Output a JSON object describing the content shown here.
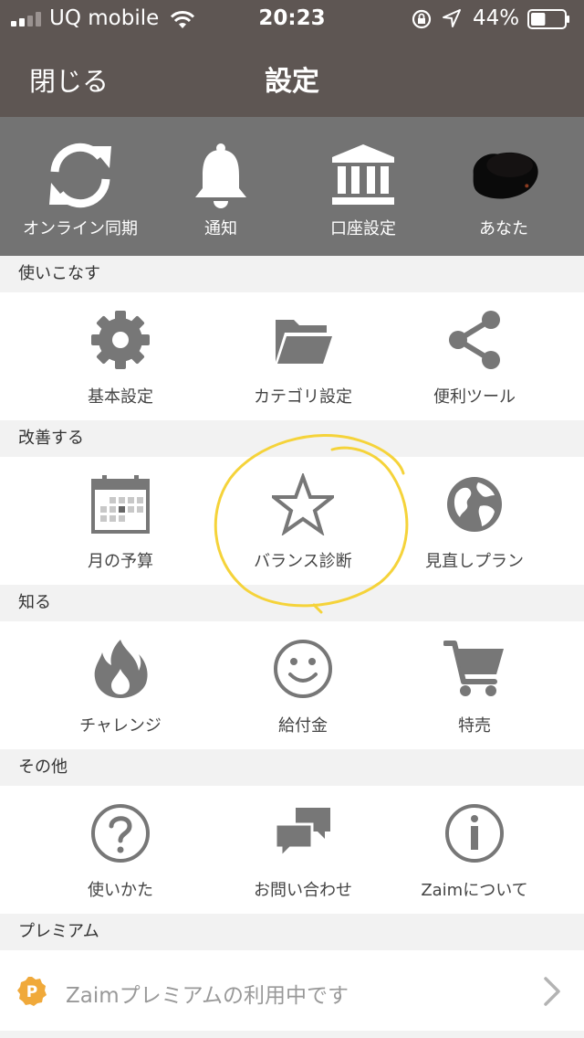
{
  "status_bar": {
    "carrier": "UQ mobile",
    "time": "20:23",
    "battery_percent": "44%",
    "battery_level": 0.44,
    "signal_bars_filled": 2,
    "signal_bars_total": 4
  },
  "nav": {
    "close_label": "閉じる",
    "title": "設定"
  },
  "top_menu": {
    "items": [
      {
        "label": "オンライン同期",
        "icon": "sync-icon"
      },
      {
        "label": "通知",
        "icon": "bell-icon"
      },
      {
        "label": "口座設定",
        "icon": "bank-icon"
      },
      {
        "label": "あなた",
        "icon": "avatar"
      }
    ]
  },
  "sections": [
    {
      "title": "使いこなす",
      "items": [
        {
          "label": "基本設定",
          "icon": "gear-icon"
        },
        {
          "label": "カテゴリ設定",
          "icon": "folder-icon"
        },
        {
          "label": "便利ツール",
          "icon": "share-icon"
        }
      ]
    },
    {
      "title": "改善する",
      "items": [
        {
          "label": "月の予算",
          "icon": "calendar-icon"
        },
        {
          "label": "バランス診断",
          "icon": "star-icon"
        },
        {
          "label": "見直しプラン",
          "icon": "globe-icon"
        }
      ]
    },
    {
      "title": "知る",
      "items": [
        {
          "label": "チャレンジ",
          "icon": "fire-icon"
        },
        {
          "label": "給付金",
          "icon": "smile-icon"
        },
        {
          "label": "特売",
          "icon": "cart-icon"
        }
      ]
    },
    {
      "title": "その他",
      "items": [
        {
          "label": "使いかた",
          "icon": "help-icon"
        },
        {
          "label": "お問い合わせ",
          "icon": "chat-icon"
        },
        {
          "label": "Zaimについて",
          "icon": "info-icon"
        }
      ]
    }
  ],
  "premium": {
    "section_title": "プレミアム",
    "badge": "P",
    "text": "Zaimプレミアムの利用中です"
  },
  "colors": {
    "header_bg": "#5e5653",
    "top_menu_bg": "#737373",
    "icon_gray": "#777777",
    "annotation_yellow": "#f5d33a",
    "premium_badge": "#f0a93a"
  }
}
